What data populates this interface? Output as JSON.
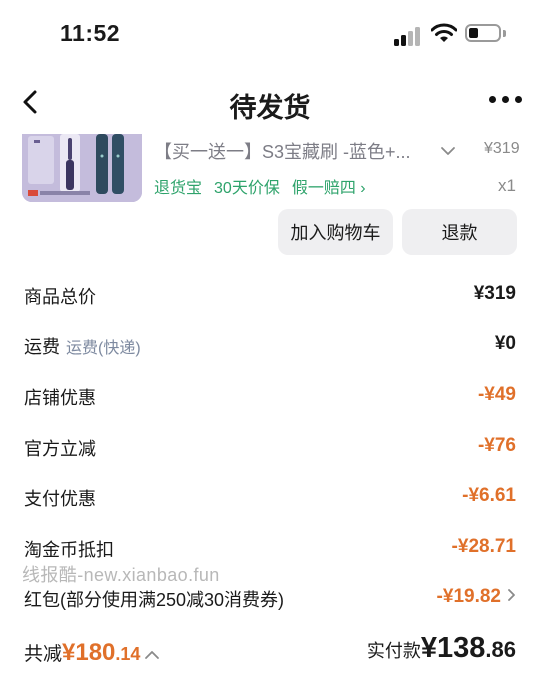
{
  "status_bar": {
    "time": "11:52"
  },
  "nav": {
    "title": "待发货"
  },
  "product": {
    "name": "【买一送一】S3宝藏刷 -蓝色+...",
    "price": "¥319",
    "quantity": "x1",
    "tags": [
      "退货宝",
      "30天价保",
      "假一赔四 ›"
    ]
  },
  "actions": {
    "add_to_cart": "加入购物车",
    "refund": "退款"
  },
  "summary": [
    {
      "label": "商品总价",
      "value": "¥319"
    },
    {
      "label": "运费",
      "sub": "运费(快递)",
      "value": "¥0"
    },
    {
      "label": "店铺优惠",
      "value": "-¥49"
    },
    {
      "label": "官方立减",
      "value": "-¥76"
    },
    {
      "label": "支付优惠",
      "value": "-¥6.61"
    },
    {
      "label": "淘金币抵扣",
      "value": "-¥28.71"
    },
    {
      "label": "红包(部分使用满250减30消费券)",
      "value": "-¥19.82"
    }
  ],
  "watermark": "线报酷-new.xianbao.fun",
  "footer": {
    "total_discount_label": "共减",
    "total_discount_yuan": "¥180",
    "total_discount_cents": ".14",
    "paid_label": "实付款",
    "paid_yuan": "¥138",
    "paid_cents": ".86"
  },
  "colors": {
    "accent": "#e0702a",
    "green": "#2ea36b"
  }
}
